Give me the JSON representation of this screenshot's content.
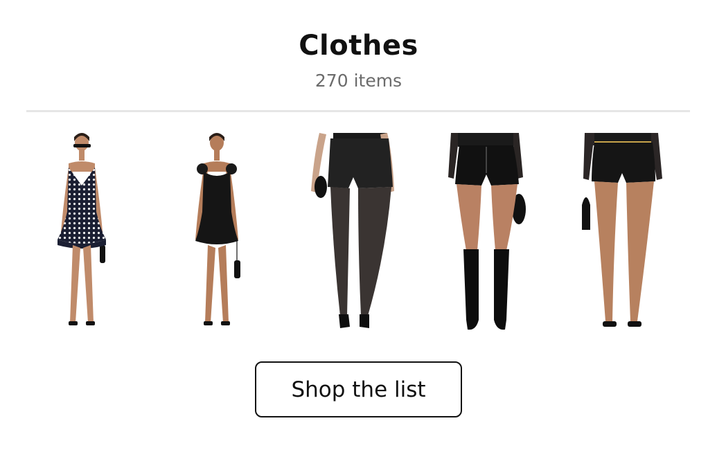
{
  "list": {
    "title": "Clothes",
    "item_count": "270 items"
  },
  "products": [
    {
      "name": "Polka dot mini dress",
      "icon": "polka-dot-dress-product-image"
    },
    {
      "name": "Black mini dress",
      "icon": "black-dress-product-image"
    },
    {
      "name": "Black shorts with sheer tights",
      "icon": "black-shorts-product-image"
    },
    {
      "name": "Leather shorts with knee boots",
      "icon": "leather-shorts-product-image"
    },
    {
      "name": "Black micro shorts",
      "icon": "micro-shorts-product-image"
    }
  ],
  "actions": {
    "shop_label": "Shop the list"
  },
  "colors": {
    "text": "#111111",
    "muted": "#6b6b6b",
    "divider": "#e6e6e6",
    "skin": "#c08b6a",
    "garment": "#1a1a1a"
  }
}
